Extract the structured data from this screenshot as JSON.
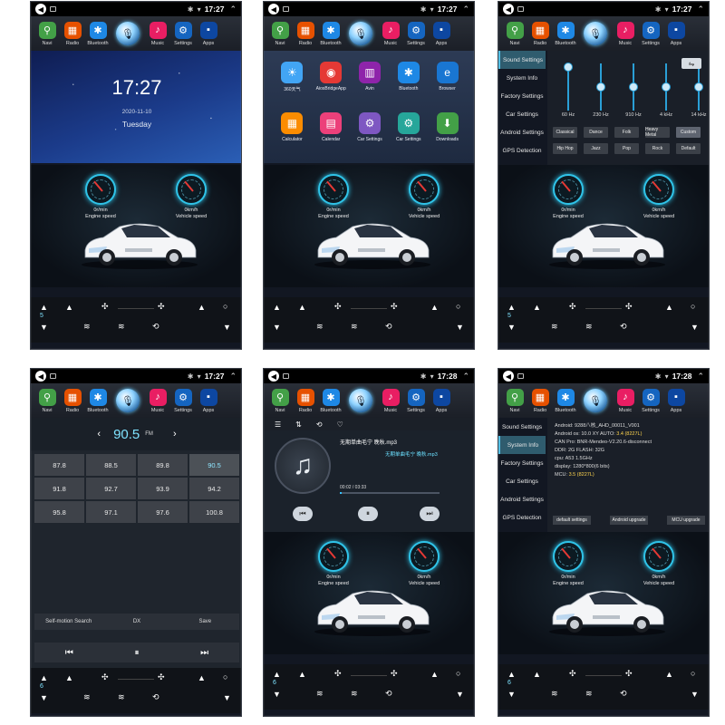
{
  "dock": [
    {
      "label": "Navi",
      "glyph": "⚲",
      "cls": "navi"
    },
    {
      "label": "Radio",
      "glyph": "▦",
      "cls": "radio"
    },
    {
      "label": "Bluetooth",
      "glyph": "✱",
      "cls": "bt"
    },
    {
      "label": "Music",
      "glyph": "♪",
      "cls": "music"
    },
    {
      "label": "Settings",
      "glyph": "⚙",
      "cls": "settings"
    },
    {
      "label": "Apps",
      "glyph": "▪",
      "cls": "apps"
    }
  ],
  "dashboard": {
    "left_gauge_value": "0r/min",
    "left_gauge_label": "Engine speed",
    "right_gauge_value": "0km/h",
    "right_gauge_label": "Vehicle speed"
  },
  "panels": {
    "home": {
      "time": "17:27",
      "clock": "17:27",
      "date": "2020-11-10",
      "day": "Tuesday",
      "fan": "5"
    },
    "apps": {
      "time": "17:27",
      "fan": "",
      "grid": [
        {
          "label": "360天气",
          "glyph": "☀",
          "color": "#42a5f5"
        },
        {
          "label": "AiosBridgeApp",
          "glyph": "◉",
          "color": "#e53935"
        },
        {
          "label": "Avin",
          "glyph": "▥",
          "color": "#8e24aa"
        },
        {
          "label": "Bluetooth",
          "glyph": "✱",
          "color": "#1e88e5"
        },
        {
          "label": "Browser",
          "glyph": "e",
          "color": "#1976d2"
        },
        {
          "label": "Calculator",
          "glyph": "▦",
          "color": "#fb8c00"
        },
        {
          "label": "Calendar",
          "glyph": "▤",
          "color": "#ec407a"
        },
        {
          "label": "Car Settings",
          "glyph": "⚙",
          "color": "#7e57c2"
        },
        {
          "label": "Car Settings",
          "glyph": "⚙",
          "color": "#26a69a"
        },
        {
          "label": "Downloads",
          "glyph": "⬇",
          "color": "#43a047"
        }
      ]
    },
    "sound": {
      "time": "17:27",
      "fan": "5",
      "menu": [
        "Sound Settings",
        "System Info",
        "Factory Settings",
        "Car Settings",
        "Android Settings",
        "GPS Detection"
      ],
      "active_menu": 0,
      "bands": [
        {
          "label": "60 Hz",
          "level": 0.92
        },
        {
          "label": "230 Hz",
          "level": 0.5
        },
        {
          "label": "910 Hz",
          "level": 0.5
        },
        {
          "label": "4 kHz",
          "level": 0.5
        },
        {
          "label": "14 kHz",
          "level": 0.5
        }
      ],
      "toggle": "⇋",
      "presets_row1": [
        "Classical",
        "Dance",
        "Folk",
        "Heavy Metal",
        "Custom"
      ],
      "presets_row2": [
        "Hip Hop",
        "Jazz",
        "Pop",
        "Rock",
        "Default"
      ],
      "active_preset": "Custom"
    },
    "radio": {
      "time": "17:27",
      "fan": "6",
      "frequency": "90.5",
      "unit": "FM",
      "prev": "‹",
      "next": "›",
      "presets": [
        "87.8",
        "88.5",
        "89.8",
        "90.5",
        "91.8",
        "92.7",
        "93.9",
        "94.2",
        "95.8",
        "97.1",
        "97.6",
        "100.8"
      ],
      "active_preset": "90.5",
      "funcs": [
        "Self-motion Search",
        "DX",
        "Save"
      ],
      "controls": [
        "⏮",
        "⏸",
        "⏭"
      ]
    },
    "music": {
      "time": "17:28",
      "fan": "6",
      "toolbar": [
        "☰",
        "⇅",
        "⟲",
        "♡"
      ],
      "song": "无期单曲毛宁 晚秋.mp3",
      "song2": "无期单曲毛宁 晚秋.mp3",
      "elapsed": "00:02 / 03:33",
      "progress": 0.01,
      "controls": [
        "⏮",
        "⏸",
        "⏭"
      ]
    },
    "sysinfo": {
      "time": "17:28",
      "fan": "6",
      "menu": [
        "Sound Settings",
        "System Info",
        "Factory Settings",
        "Car Settings",
        "Android Settings",
        "GPS Detection"
      ],
      "active_menu": 1,
      "rows": [
        {
          "k": "Android:",
          "v": "9288八核_AHD_00011_V001",
          "hl": ""
        },
        {
          "k": "Android os:",
          "v": "10.0   XY AUTO: ",
          "hl": "3.4 (8227L)"
        },
        {
          "k": "CAN Pro:",
          "v": "BNR-Mendeo-V2.20.6-disconnect",
          "hl": ""
        },
        {
          "k": "DDR:",
          "v": "2G    FLASH: 32G",
          "hl": ""
        },
        {
          "k": "cpu:",
          "v": "A53 1.5GHz",
          "hl": ""
        },
        {
          "k": "display:",
          "v": "1280*800(6 bits)",
          "hl": ""
        },
        {
          "k": "MCU:",
          "v": "",
          "hl": "3.5 (8227L)"
        }
      ],
      "buttons": [
        "default settings",
        "Android upgrade",
        "MCU upgrade"
      ]
    }
  }
}
